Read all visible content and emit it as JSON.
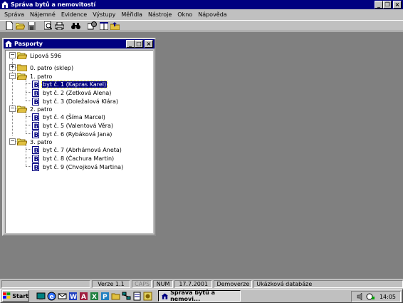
{
  "app": {
    "title": "Správa bytů a nemovitostí",
    "title_bar_color": "#000080"
  },
  "window_buttons": {
    "minimize": "_",
    "maximize": "□",
    "restore": "❐",
    "close": "×"
  },
  "menu": [
    "Správa",
    "Nájemné",
    "Evidence",
    "Výstupy",
    "Měřidla",
    "Nástroje",
    "Okno",
    "Nápověda"
  ],
  "toolbar": [
    "new-doc-icon",
    "open-folder-icon",
    "save-icon",
    "print-preview-icon",
    "print-icon",
    "binoculars-icon",
    "settings-icon",
    "window-icon",
    "export-icon"
  ],
  "child_window": {
    "title": "Pasporty",
    "tree": {
      "root": "Lipová 596",
      "floors": [
        {
          "label": "0. patro (sklep)",
          "expanded": false,
          "flats": []
        },
        {
          "label": "1. patro",
          "expanded": true,
          "flats": [
            {
              "label": "byt č. 1 (Kapras Karel)",
              "selected": true
            },
            {
              "label": "byt č. 2 (Zetková Alena)",
              "selected": false
            },
            {
              "label": "byt č. 3 (Doležalová Klára)",
              "selected": false
            }
          ]
        },
        {
          "label": "2. patro",
          "expanded": true,
          "flats": [
            {
              "label": "byt č. 4 (Šíma Marcel)",
              "selected": false
            },
            {
              "label": "byt č. 5 (Valentová Věra)",
              "selected": false
            },
            {
              "label": "byt č. 6 (Rybáková Jana)",
              "selected": false
            }
          ]
        },
        {
          "label": "3. patro",
          "expanded": true,
          "flats": [
            {
              "label": "byt č. 7 (Abrhámová Aneta)",
              "selected": false
            },
            {
              "label": "byt č. 8 (Čachura Martin)",
              "selected": false
            },
            {
              "label": "byt č. 9 (Chvojková Martina)",
              "selected": false
            }
          ]
        }
      ]
    }
  },
  "status": {
    "version": "Verze 1.1",
    "caps": "CAPS",
    "num": "NUM",
    "date": "17.7.2001",
    "mode": "Demoverze",
    "database": "Ukázková databáze"
  },
  "taskbar": {
    "start": "Start",
    "task_label": "Správa bytů a nemovi...",
    "clock": "14:05"
  }
}
